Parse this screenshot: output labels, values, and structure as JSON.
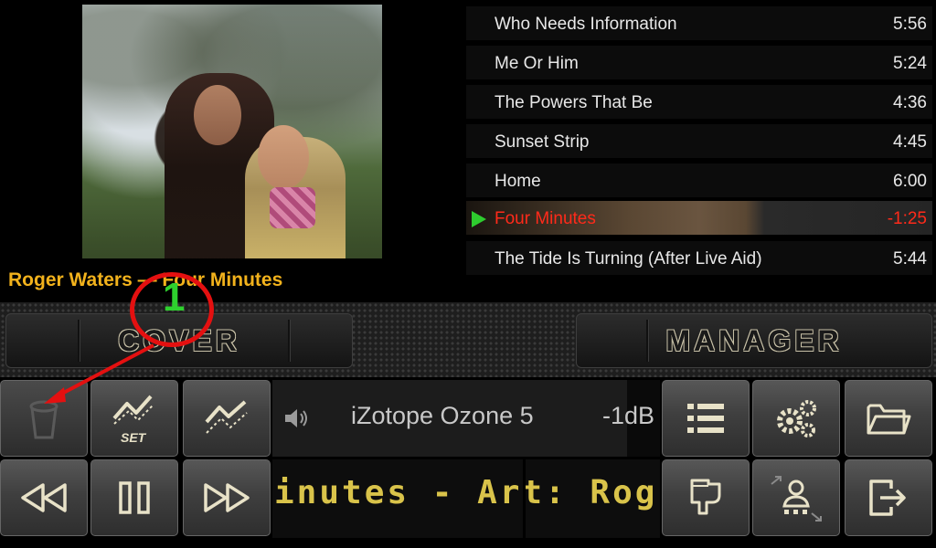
{
  "now_playing": "Roger Waters — Four Minutes",
  "playlist": [
    {
      "title": "Who Needs Information",
      "duration": "5:56",
      "active": false
    },
    {
      "title": "Me Or Him",
      "duration": "5:24",
      "active": false
    },
    {
      "title": "The Powers That Be",
      "duration": "4:36",
      "active": false
    },
    {
      "title": "Sunset Strip",
      "duration": "4:45",
      "active": false
    },
    {
      "title": "Home",
      "duration": "6:00",
      "active": false
    },
    {
      "title": "Four Minutes",
      "duration": "-1:25",
      "active": true
    },
    {
      "title": "The Tide Is Turning (After Live Aid)",
      "duration": "5:44",
      "active": false
    }
  ],
  "modes": {
    "cover": "COVER",
    "manager": "MANAGER"
  },
  "controls": {
    "set_label": "SET"
  },
  "dsp": {
    "name": "iZotope Ozone 5",
    "gain": "-1dB"
  },
  "marquee": {
    "text": "inutes - Art: Rog"
  },
  "annotation": {
    "number": "1"
  },
  "colors": {
    "accent_text": "#f2b21c",
    "active_track": "#ff2a1a",
    "play_indicator": "#2ecc2e",
    "annotation": "#e41010",
    "annotation_number": "#2ed12e"
  }
}
